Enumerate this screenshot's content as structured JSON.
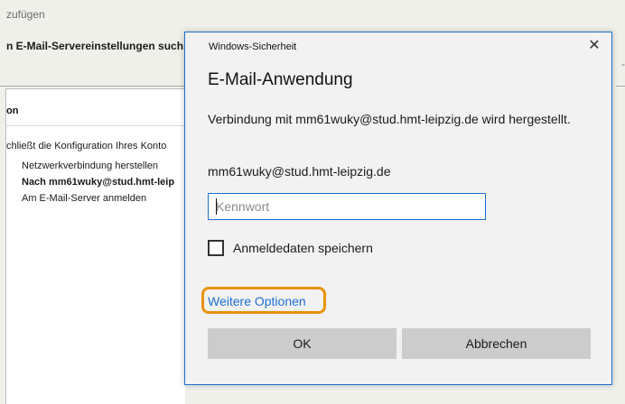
{
  "background": {
    "title": "zufügen",
    "header": "n E-Mail-Servereinstellungen such",
    "right_dash": "-",
    "panel_header": "on",
    "status": "chließt die Konfiguration Ihres Konto",
    "steps": [
      "Netzwerkverbindung herstellen",
      "Nach mm61wuky@stud.hmt-leip",
      "Am E-Mail-Server anmelden"
    ]
  },
  "dialog": {
    "caption": "Windows-Sicherheit",
    "close_symbol": "✕",
    "heading": "E-Mail-Anwendung",
    "message": "Verbindung mit mm61wuky@stud.hmt-leipzig.de wird hergestellt.",
    "account": "mm61wuky@stud.hmt-leipzig.de",
    "password_placeholder": "Kennwort",
    "password_value": "",
    "save_credentials_label": "Anmeldedaten speichern",
    "save_credentials_checked": false,
    "more_options": "Weitere Optionen",
    "ok": "OK",
    "cancel": "Abbrechen",
    "highlight_color": "#e8930f",
    "accent_color": "#1e6fd1"
  }
}
